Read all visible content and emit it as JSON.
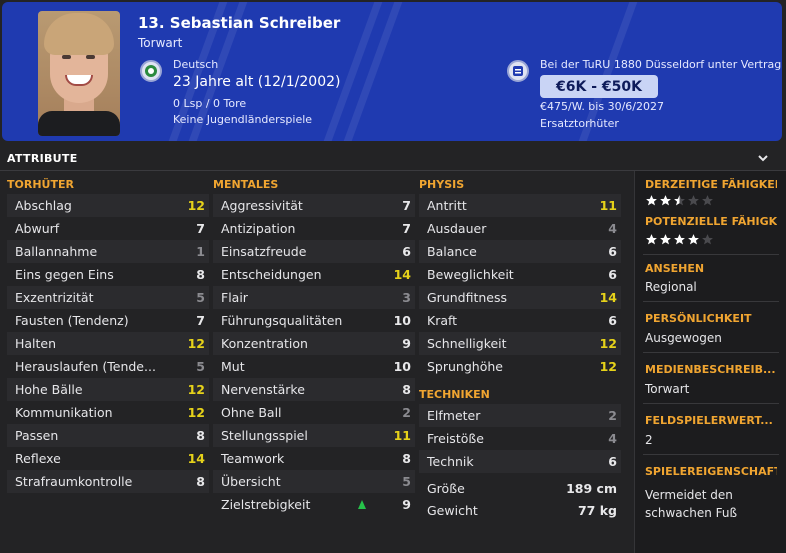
{
  "header": {
    "player_name": "13. Sebastian Schreiber",
    "position": "Torwart",
    "nationality": "Deutsch",
    "age": "23 Jahre alt (12/1/2002)",
    "caps": "0 Lsp / 0 Tore",
    "youth_caps": "Keine Jugendländerspiele",
    "contract_club": "Bei der TuRU 1880 Düsseldorf unter Vertrag",
    "value": "€6K - €50K",
    "wage": "€475/W. bis 30/6/2027",
    "squad_status": "Ersatztorhüter",
    "colors": {
      "background": "#1f3ab0",
      "value_box": "#c9d4f5"
    }
  },
  "section": {
    "title": "ATTRIBUTE"
  },
  "goalkeeping": {
    "title": "TORHÜTER",
    "rows": [
      {
        "name": "Abschlag",
        "value": "12"
      },
      {
        "name": "Abwurf",
        "value": "7"
      },
      {
        "name": "Ballannahme",
        "value": "1"
      },
      {
        "name": "Eins gegen Eins",
        "value": "8"
      },
      {
        "name": "Exzentrizität",
        "value": "5"
      },
      {
        "name": "Fausten (Tendenz)",
        "value": "7"
      },
      {
        "name": "Halten",
        "value": "12"
      },
      {
        "name": "Herauslaufen (Tende...",
        "value": "5"
      },
      {
        "name": "Hohe Bälle",
        "value": "12"
      },
      {
        "name": "Kommunikation",
        "value": "12"
      },
      {
        "name": "Passen",
        "value": "8"
      },
      {
        "name": "Reflexe",
        "value": "14"
      },
      {
        "name": "Strafraumkontrolle",
        "value": "8"
      }
    ]
  },
  "mental": {
    "title": "MENTALES",
    "rows": [
      {
        "name": "Aggressivität",
        "value": "7"
      },
      {
        "name": "Antizipation",
        "value": "7"
      },
      {
        "name": "Einsatzfreude",
        "value": "6"
      },
      {
        "name": "Entscheidungen",
        "value": "14"
      },
      {
        "name": "Flair",
        "value": "3"
      },
      {
        "name": "Führungsqualitäten",
        "value": "10"
      },
      {
        "name": "Konzentration",
        "value": "9"
      },
      {
        "name": "Mut",
        "value": "10"
      },
      {
        "name": "Nervenstärke",
        "value": "8"
      },
      {
        "name": "Ohne Ball",
        "value": "2"
      },
      {
        "name": "Stellungsspiel",
        "value": "11"
      },
      {
        "name": "Teamwork",
        "value": "8"
      },
      {
        "name": "Übersicht",
        "value": "5"
      },
      {
        "name": "Zielstrebigkeit",
        "value": "9"
      }
    ]
  },
  "physical": {
    "title": "PHYSIS",
    "rows": [
      {
        "name": "Antritt",
        "value": "11"
      },
      {
        "name": "Ausdauer",
        "value": "4"
      },
      {
        "name": "Balance",
        "value": "6"
      },
      {
        "name": "Beweglichkeit",
        "value": "6"
      },
      {
        "name": "Grundfitness",
        "value": "14"
      },
      {
        "name": "Kraft",
        "value": "6"
      },
      {
        "name": "Schnelligkeit",
        "value": "12"
      },
      {
        "name": "Sprunghöhe",
        "value": "12"
      }
    ]
  },
  "technical": {
    "title": "TECHNIKEN",
    "rows": [
      {
        "name": "Elfmeter",
        "value": "2"
      },
      {
        "name": "Freistöße",
        "value": "4"
      },
      {
        "name": "Technik",
        "value": "6"
      }
    ]
  },
  "body": {
    "height_label": "Größe",
    "height": "189 cm",
    "weight_label": "Gewicht",
    "weight": "77 kg"
  },
  "side": {
    "current_ability_label": "DERZEITIGE FÄHIGKEIT",
    "current_ability_stars": 2.5,
    "potential_ability_label": "POTENZIELLE FÄHIGK...",
    "potential_ability_stars": 4,
    "reputation_label": "ANSEHEN",
    "reputation": "Regional",
    "personality_label": "PERSÖNLICHKEIT",
    "personality": "Ausgewogen",
    "media_label": "MEDIENBESCHREIB...",
    "media": "Torwart",
    "outfield_label": "FELDSPIELERWERT...",
    "outfield": "2",
    "traits_label": "SPIELEREIGENSCHAFT",
    "traits_line1": "Vermeidet den",
    "traits_line2": "schwachen Fuß",
    "colors": {
      "accent": "#f0a531",
      "star": "#ffffff"
    }
  }
}
